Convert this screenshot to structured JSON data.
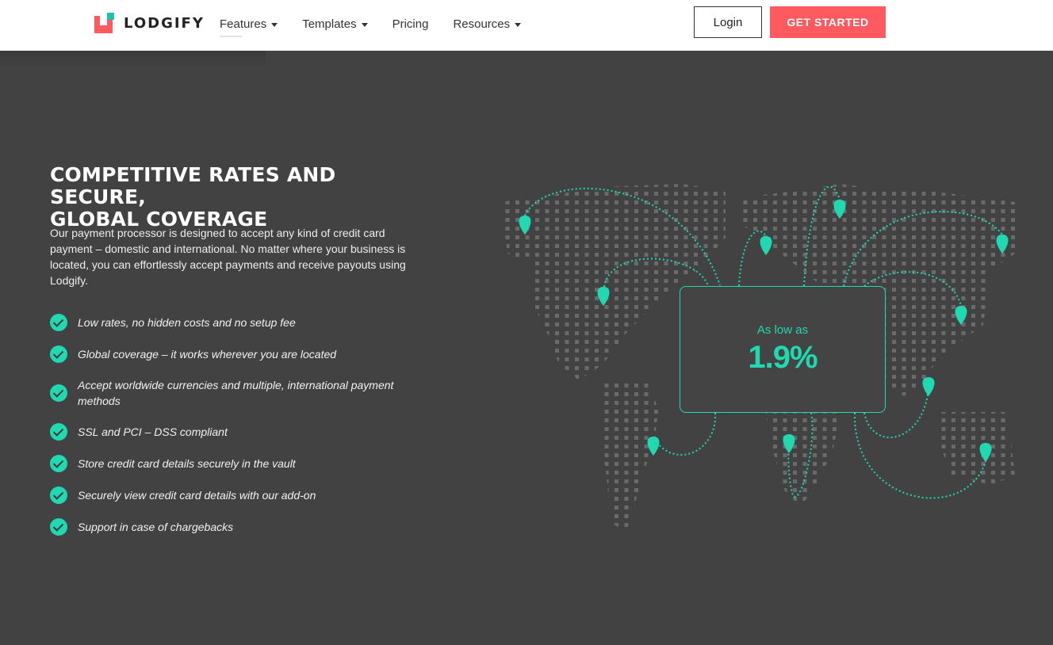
{
  "nav": {
    "brand": "LODGIFY",
    "menu": [
      {
        "label": "Features",
        "dropdown": true
      },
      {
        "label": "Templates",
        "dropdown": true
      },
      {
        "label": "Pricing",
        "dropdown": false
      },
      {
        "label": "Resources",
        "dropdown": true
      }
    ],
    "login_label": "Login",
    "cta_label": "GET STARTED"
  },
  "hero": {
    "heading_line1": "COMPETITIVE RATES AND SECURE,",
    "heading_line2": "GLOBAL COVERAGE",
    "description": "Our payment processor is designed to accept any kind of credit card payment – domestic and international. No matter where your business is located, you can effortlessly accept payments and receive payouts using Lodgify.",
    "features": [
      "Low rates, no hidden costs and no setup fee",
      "Global coverage – it works wherever you are located",
      "Accept worldwide currencies and multiple, international payment methods",
      "SSL and PCI – DSS compliant",
      "Store credit card details securely in the vault",
      "Securely view credit card details with our add-on",
      "Support in case of chargebacks"
    ]
  },
  "rate": {
    "label": "As low as",
    "value": "1.9%"
  },
  "colors": {
    "background": "#424242",
    "accent": "#20d9b0",
    "brand_red": "#ff5a5f",
    "brand_teal": "#20c2a6"
  },
  "icons": [
    "lodgify-logo-icon",
    "caret-down-icon",
    "check-circle-icon",
    "map-pin-icon"
  ]
}
